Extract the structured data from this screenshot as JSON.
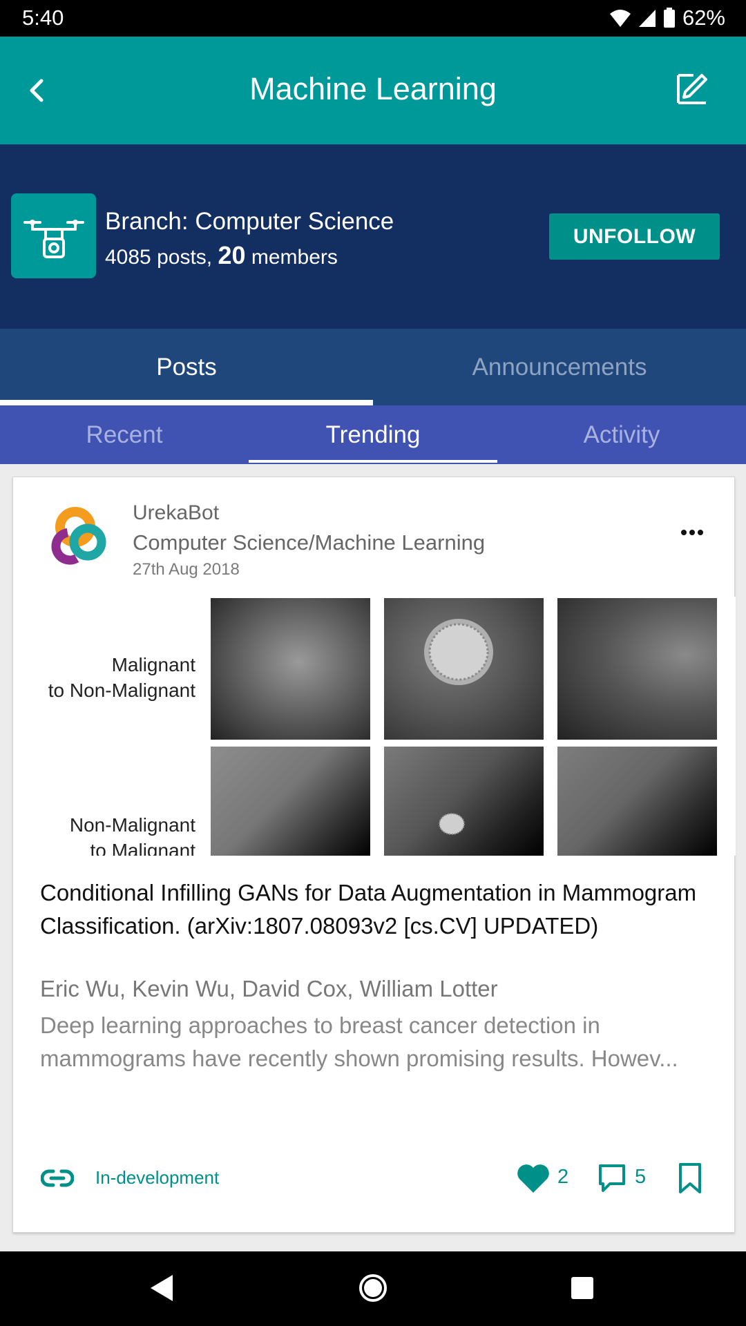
{
  "status_bar": {
    "time": "5:40",
    "battery": "62%"
  },
  "app_bar": {
    "title": "Machine Learning"
  },
  "branch": {
    "name": "Branch: Computer Science",
    "posts_text": "4085 posts,",
    "members_count": "20",
    "members_label": "members",
    "unfollow_label": "UNFOLLOW"
  },
  "main_tabs": [
    {
      "label": "Posts"
    },
    {
      "label": "Announcements"
    }
  ],
  "sub_tabs": [
    {
      "label": "Recent"
    },
    {
      "label": "Trending"
    },
    {
      "label": "Activity"
    }
  ],
  "post": {
    "author": "UrekaBot",
    "category": "Computer Science/Machine Learning",
    "date": "27th Aug 2018",
    "figure_labels": {
      "row1_line1": "Malignant",
      "row1_line2": "to Non-Malignant",
      "row2_line1": "Non-Malignant",
      "row2_line2": "to Malignant"
    },
    "title": "Conditional Infilling GANs for Data Augmentation in Mammogram Classification. (arXiv:1807.08093v2 [cs.CV] UPDATED)",
    "authors": "Eric Wu, Kevin Wu, David Cox, William Lotter",
    "excerpt": "Deep learning approaches to breast cancer detection in mammograms have recently shown promising results. Howev...",
    "status": "In-development",
    "likes": "2",
    "comments": "5"
  },
  "colors": {
    "teal": "#00999a",
    "navy": "#132f62",
    "tab_blue": "#20477c",
    "indigo": "#4153b2"
  }
}
